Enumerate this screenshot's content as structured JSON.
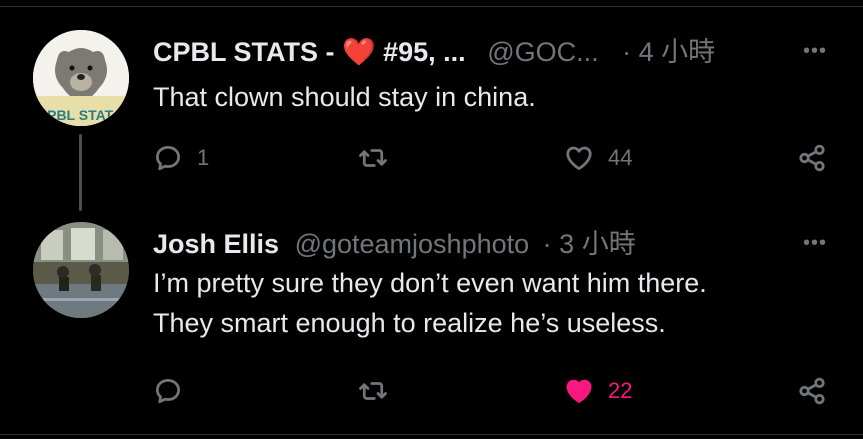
{
  "tweets": [
    {
      "name": "CPBL STATS - ❤️ #95, ...",
      "handle": "@GOC...",
      "sep": "·",
      "time": "4 小時",
      "text_lines": [
        "That clown should stay in china."
      ],
      "avatar_text": "CPBL STAT",
      "reply_count": "1",
      "retweet_count": "",
      "like_count": "44",
      "liked": false
    },
    {
      "name": "Josh Ellis",
      "handle": "@goteamjoshphoto",
      "sep": "·",
      "time": "3 小時",
      "text_lines": [
        "I’m pretty sure they don’t even want him there.",
        "They smart enough to realize he’s useless."
      ],
      "reply_count": "",
      "retweet_count": "",
      "like_count": "22",
      "liked": true
    }
  ],
  "more_label": "•••",
  "colors": {
    "muted": "#71767b",
    "like_active": "#f91880",
    "text": "#e7e9ea",
    "background": "#000000"
  },
  "icons": [
    "reply-icon",
    "retweet-icon",
    "like-icon",
    "share-icon",
    "more-icon"
  ]
}
